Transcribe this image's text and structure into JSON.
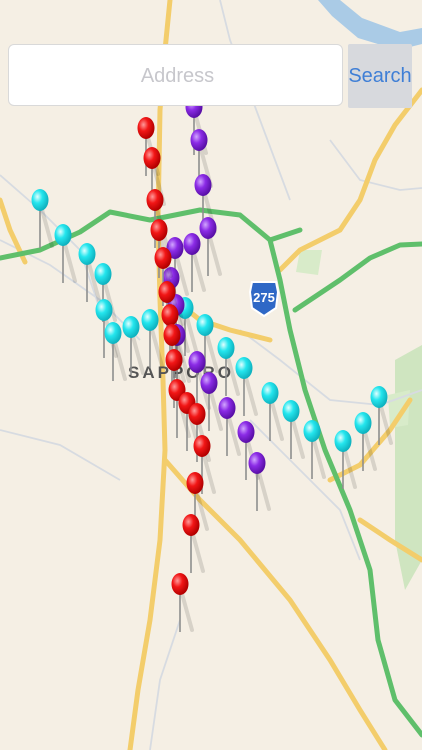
{
  "search": {
    "placeholder": "Address",
    "value": "",
    "button_label": "Search"
  },
  "map": {
    "city_label": "SAPPORO",
    "highway_shield": "275",
    "pin_colors": {
      "red": "#f01010",
      "purple": "#8a2be2",
      "cyan": "#22e0ea"
    }
  }
}
